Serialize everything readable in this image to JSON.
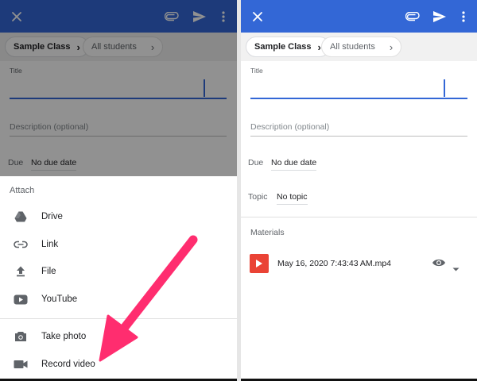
{
  "colors": {
    "appbar": "#3367d6",
    "accent": "#3367d6",
    "arrow": "#ff2d6f",
    "video_thumb": "#ea4335"
  },
  "left": {
    "appbar": {
      "icons": [
        "close-icon",
        "attach-icon",
        "send-icon",
        "more-vert-icon"
      ]
    },
    "breadcrumb": {
      "class_label": "Sample Class",
      "students_label": "All students"
    },
    "form": {
      "title_label": "Title",
      "description_placeholder": "Description (optional)",
      "due_label": "Due",
      "due_value": "No due date"
    },
    "attach_sheet": {
      "title": "Attach",
      "items": [
        {
          "icon": "drive-icon",
          "label": "Drive"
        },
        {
          "icon": "link-icon",
          "label": "Link"
        },
        {
          "icon": "upload-icon",
          "label": "File"
        },
        {
          "icon": "youtube-icon",
          "label": "YouTube"
        },
        {
          "icon": "camera-icon",
          "label": "Take photo"
        },
        {
          "icon": "videocam-icon",
          "label": "Record video"
        }
      ]
    }
  },
  "right": {
    "appbar": {
      "icons": [
        "close-icon",
        "attach-icon",
        "send-icon",
        "more-vert-icon"
      ]
    },
    "breadcrumb": {
      "class_label": "Sample Class",
      "students_label": "All students"
    },
    "form": {
      "title_label": "Title",
      "description_placeholder": "Description (optional)",
      "due_label": "Due",
      "due_value": "No due date",
      "topic_label": "Topic",
      "topic_value": "No topic"
    },
    "materials": {
      "heading": "Materials",
      "items": [
        {
          "icon": "play-icon",
          "name": "May 16, 2020 7:43:43 AM.mp4",
          "visibility_icon": "eye-icon"
        }
      ]
    }
  },
  "annotation": {
    "type": "arrow",
    "points_to": "Record video"
  }
}
